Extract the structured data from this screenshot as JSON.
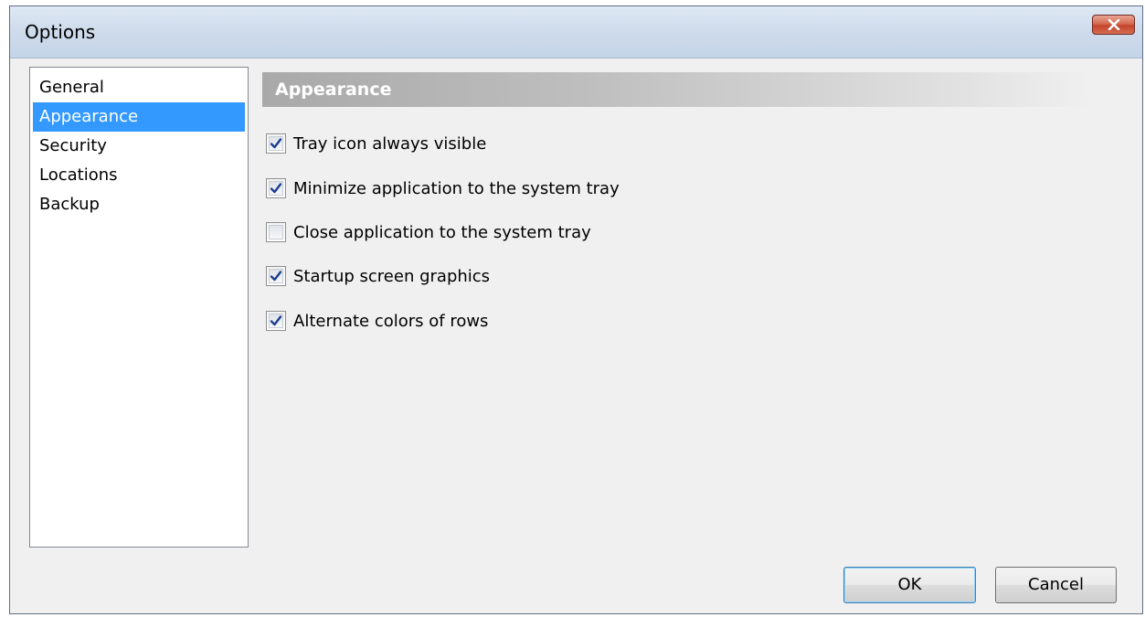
{
  "window": {
    "title": "Options"
  },
  "nav": {
    "items": [
      {
        "label": "General",
        "selected": false
      },
      {
        "label": "Appearance",
        "selected": true
      },
      {
        "label": "Security",
        "selected": false
      },
      {
        "label": "Locations",
        "selected": false
      },
      {
        "label": "Backup",
        "selected": false
      }
    ]
  },
  "section": {
    "title": "Appearance"
  },
  "options": [
    {
      "label": "Tray icon always visible",
      "checked": true
    },
    {
      "label": "Minimize application to the system tray",
      "checked": true
    },
    {
      "label": "Close application to the system tray",
      "checked": false
    },
    {
      "label": "Startup screen graphics",
      "checked": true
    },
    {
      "label": "Alternate colors of rows",
      "checked": true
    }
  ],
  "buttons": {
    "ok_label": "OK",
    "cancel_label": "Cancel"
  },
  "colors": {
    "selection": "#3399ff",
    "close_button": "#c4442b"
  },
  "icons": {
    "close": "close-icon",
    "check": "checkmark-icon"
  }
}
